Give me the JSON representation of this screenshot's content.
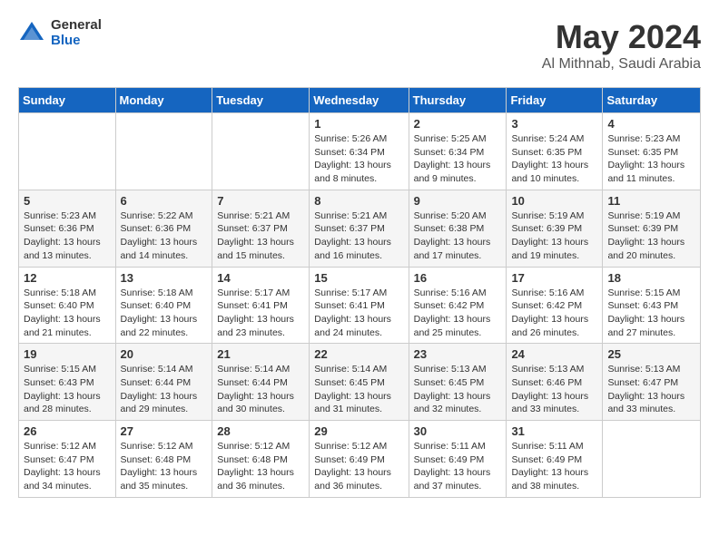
{
  "logo": {
    "general": "General",
    "blue": "Blue"
  },
  "header": {
    "month": "May 2024",
    "location": "Al Mithnab, Saudi Arabia"
  },
  "weekdays": [
    "Sunday",
    "Monday",
    "Tuesday",
    "Wednesday",
    "Thursday",
    "Friday",
    "Saturday"
  ],
  "weeks": [
    [
      {
        "day": "",
        "info": ""
      },
      {
        "day": "",
        "info": ""
      },
      {
        "day": "",
        "info": ""
      },
      {
        "day": "1",
        "info": "Sunrise: 5:26 AM\nSunset: 6:34 PM\nDaylight: 13 hours and 8 minutes."
      },
      {
        "day": "2",
        "info": "Sunrise: 5:25 AM\nSunset: 6:34 PM\nDaylight: 13 hours and 9 minutes."
      },
      {
        "day": "3",
        "info": "Sunrise: 5:24 AM\nSunset: 6:35 PM\nDaylight: 13 hours and 10 minutes."
      },
      {
        "day": "4",
        "info": "Sunrise: 5:23 AM\nSunset: 6:35 PM\nDaylight: 13 hours and 11 minutes."
      }
    ],
    [
      {
        "day": "5",
        "info": "Sunrise: 5:23 AM\nSunset: 6:36 PM\nDaylight: 13 hours and 13 minutes."
      },
      {
        "day": "6",
        "info": "Sunrise: 5:22 AM\nSunset: 6:36 PM\nDaylight: 13 hours and 14 minutes."
      },
      {
        "day": "7",
        "info": "Sunrise: 5:21 AM\nSunset: 6:37 PM\nDaylight: 13 hours and 15 minutes."
      },
      {
        "day": "8",
        "info": "Sunrise: 5:21 AM\nSunset: 6:37 PM\nDaylight: 13 hours and 16 minutes."
      },
      {
        "day": "9",
        "info": "Sunrise: 5:20 AM\nSunset: 6:38 PM\nDaylight: 13 hours and 17 minutes."
      },
      {
        "day": "10",
        "info": "Sunrise: 5:19 AM\nSunset: 6:39 PM\nDaylight: 13 hours and 19 minutes."
      },
      {
        "day": "11",
        "info": "Sunrise: 5:19 AM\nSunset: 6:39 PM\nDaylight: 13 hours and 20 minutes."
      }
    ],
    [
      {
        "day": "12",
        "info": "Sunrise: 5:18 AM\nSunset: 6:40 PM\nDaylight: 13 hours and 21 minutes."
      },
      {
        "day": "13",
        "info": "Sunrise: 5:18 AM\nSunset: 6:40 PM\nDaylight: 13 hours and 22 minutes."
      },
      {
        "day": "14",
        "info": "Sunrise: 5:17 AM\nSunset: 6:41 PM\nDaylight: 13 hours and 23 minutes."
      },
      {
        "day": "15",
        "info": "Sunrise: 5:17 AM\nSunset: 6:41 PM\nDaylight: 13 hours and 24 minutes."
      },
      {
        "day": "16",
        "info": "Sunrise: 5:16 AM\nSunset: 6:42 PM\nDaylight: 13 hours and 25 minutes."
      },
      {
        "day": "17",
        "info": "Sunrise: 5:16 AM\nSunset: 6:42 PM\nDaylight: 13 hours and 26 minutes."
      },
      {
        "day": "18",
        "info": "Sunrise: 5:15 AM\nSunset: 6:43 PM\nDaylight: 13 hours and 27 minutes."
      }
    ],
    [
      {
        "day": "19",
        "info": "Sunrise: 5:15 AM\nSunset: 6:43 PM\nDaylight: 13 hours and 28 minutes."
      },
      {
        "day": "20",
        "info": "Sunrise: 5:14 AM\nSunset: 6:44 PM\nDaylight: 13 hours and 29 minutes."
      },
      {
        "day": "21",
        "info": "Sunrise: 5:14 AM\nSunset: 6:44 PM\nDaylight: 13 hours and 30 minutes."
      },
      {
        "day": "22",
        "info": "Sunrise: 5:14 AM\nSunset: 6:45 PM\nDaylight: 13 hours and 31 minutes."
      },
      {
        "day": "23",
        "info": "Sunrise: 5:13 AM\nSunset: 6:45 PM\nDaylight: 13 hours and 32 minutes."
      },
      {
        "day": "24",
        "info": "Sunrise: 5:13 AM\nSunset: 6:46 PM\nDaylight: 13 hours and 33 minutes."
      },
      {
        "day": "25",
        "info": "Sunrise: 5:13 AM\nSunset: 6:47 PM\nDaylight: 13 hours and 33 minutes."
      }
    ],
    [
      {
        "day": "26",
        "info": "Sunrise: 5:12 AM\nSunset: 6:47 PM\nDaylight: 13 hours and 34 minutes."
      },
      {
        "day": "27",
        "info": "Sunrise: 5:12 AM\nSunset: 6:48 PM\nDaylight: 13 hours and 35 minutes."
      },
      {
        "day": "28",
        "info": "Sunrise: 5:12 AM\nSunset: 6:48 PM\nDaylight: 13 hours and 36 minutes."
      },
      {
        "day": "29",
        "info": "Sunrise: 5:12 AM\nSunset: 6:49 PM\nDaylight: 13 hours and 36 minutes."
      },
      {
        "day": "30",
        "info": "Sunrise: 5:11 AM\nSunset: 6:49 PM\nDaylight: 13 hours and 37 minutes."
      },
      {
        "day": "31",
        "info": "Sunrise: 5:11 AM\nSunset: 6:49 PM\nDaylight: 13 hours and 38 minutes."
      },
      {
        "day": "",
        "info": ""
      }
    ]
  ]
}
